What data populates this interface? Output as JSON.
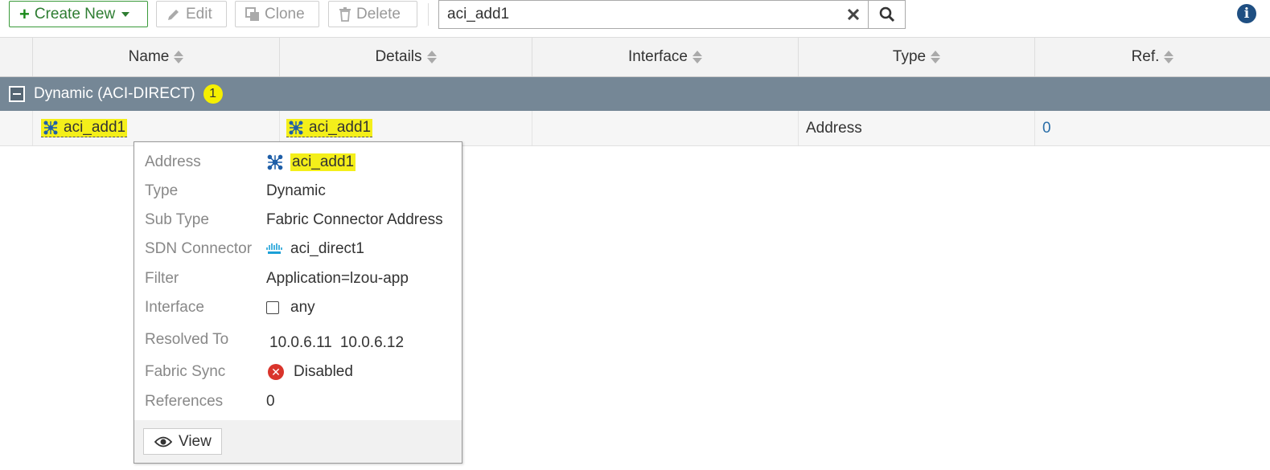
{
  "toolbar": {
    "create_label": "Create New",
    "edit_label": "Edit",
    "clone_label": "Clone",
    "delete_label": "Delete",
    "search_value": "aci_add1"
  },
  "table": {
    "columns": [
      "Name",
      "Details",
      "Interface",
      "Type",
      "Ref."
    ],
    "group": {
      "label": "Dynamic (ACI-DIRECT)",
      "count": "1"
    },
    "rows": [
      {
        "name": "aci_add1",
        "details": "aci_add1",
        "interface": "",
        "type": "Address",
        "ref": "0"
      }
    ]
  },
  "tooltip": {
    "address_label": "Address",
    "address_value": "aci_add1",
    "type_label": "Type",
    "type_value": "Dynamic",
    "subtype_label": "Sub Type",
    "subtype_value": "Fabric Connector Address",
    "sdn_label": "SDN Connector",
    "sdn_value": "aci_direct1",
    "filter_label": "Filter",
    "filter_value": "Application=lzou-app",
    "interface_label": "Interface",
    "interface_value": "any",
    "resolved_label": "Resolved To",
    "resolved_values": [
      "10.0.6.11",
      "10.0.6.12"
    ],
    "sync_label": "Fabric Sync",
    "sync_value": "Disabled",
    "references_label": "References",
    "references_value": "0",
    "view_label": "View"
  },
  "colors": {
    "group_bg": "#758796",
    "highlight": "#f4ef1a",
    "create_green": "#2e7d32",
    "link_blue": "#2a6ea8"
  },
  "icons": {
    "create": "plus-icon",
    "edit": "pencil-icon",
    "clone": "clone-icon",
    "delete": "trash-icon",
    "clear": "close-icon",
    "search": "search-icon",
    "info": "info-icon",
    "address": "fabric-address-icon",
    "sdn": "cisco-icon",
    "view": "eye-icon",
    "error": "error-icon"
  }
}
